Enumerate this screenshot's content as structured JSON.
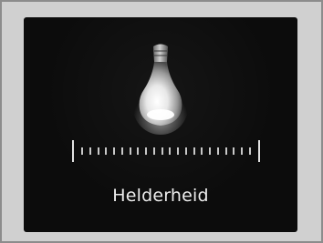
{
  "screen": {
    "icon": "light-bulb-icon",
    "label": "Helderheid",
    "slider": {
      "tick_count": 22,
      "level": 1.0
    }
  },
  "colors": {
    "frame": "#d0d0d0",
    "frame_border": "#8c8c8c",
    "screen_background": "#0c0c0c",
    "text": "#ececec",
    "ticks": "#c8c8c8"
  }
}
